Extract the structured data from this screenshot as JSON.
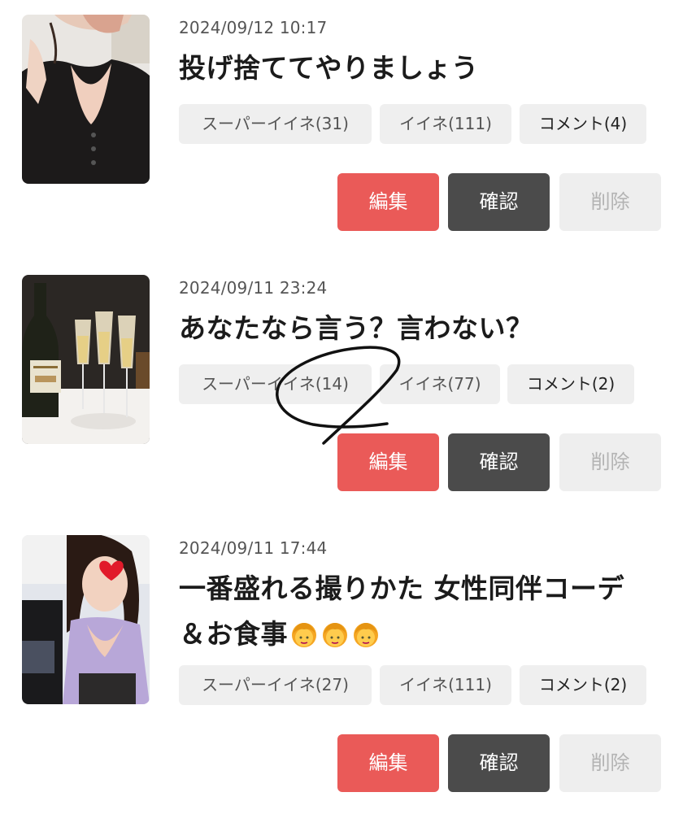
{
  "posts": [
    {
      "date": "2024/09/12 10:17",
      "title": "投げ捨ててやりましょう",
      "super_like": "スーパーイイネ(31)",
      "like": "イイネ(111)",
      "comment": "コメント(4)",
      "edit": "編集",
      "check": "確認",
      "delete": "削除"
    },
    {
      "date": "2024/09/11 23:24",
      "title": "あなたなら言う？言わない？",
      "super_like": "スーパーイイネ(14)",
      "like": "イイネ(77)",
      "comment": "コメント(2)",
      "edit": "編集",
      "check": "確認",
      "delete": "削除"
    },
    {
      "date": "2024/09/11 17:44",
      "title_line1": "一番盛れる撮りかた 女性同伴コーデ",
      "title_line2": "＆お食事",
      "super_like": "スーパーイイネ(27)",
      "like": "イイネ(111)",
      "comment": "コメント(2)",
      "edit": "編集",
      "check": "確認",
      "delete": "削除"
    }
  ],
  "colors": {
    "edit": "#ea5a58",
    "check": "#4b4b4b",
    "delete_bg": "#eeeeee",
    "badge_bg": "#efefef"
  }
}
